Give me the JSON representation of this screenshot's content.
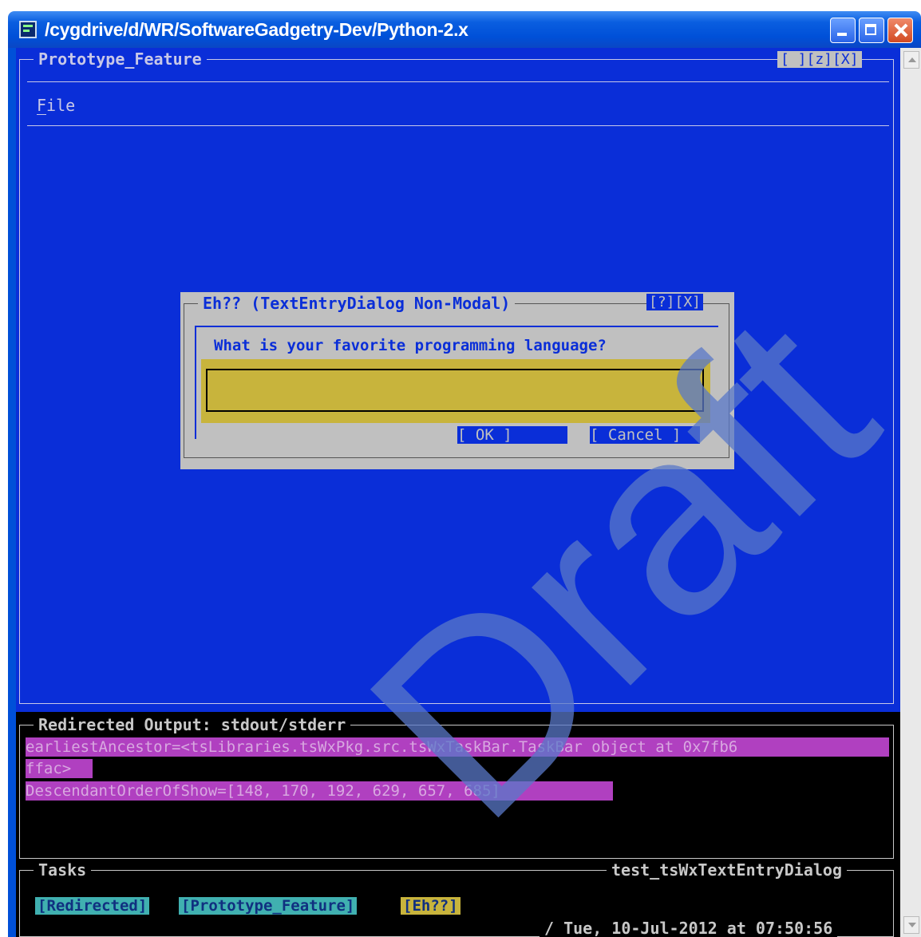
{
  "window": {
    "title": "/cygdrive/d/WR/SoftwareGadgetry-Dev/Python-2.x"
  },
  "main_window": {
    "title": "Prototype_Feature",
    "title_buttons": "[ ][z][X]",
    "menu_file": "File"
  },
  "dialog": {
    "title": "Eh?? (TextEntryDialog Non-Modal)",
    "title_buttons": "[?][X]",
    "prompt": "What is your favorite programming language?",
    "entry_value": "",
    "ok_label": "[   OK   ]",
    "cancel_label": "[ Cancel ]"
  },
  "output": {
    "title": "Redirected Output: stdout/stderr",
    "lines": [
      "earliestAncestor=<tsLibraries.tsWxPkg.src.tsWxTaskBar.TaskBar object at 0x7fb6",
      "ffac>",
      "DescendantOrderOfShow=[148, 170, 192, 629, 657, 685]"
    ]
  },
  "tasks": {
    "title": "Tasks",
    "app_name": "test_tsWxTextEntryDialog",
    "items": [
      "[Redirected]",
      "[Prototype_Feature]",
      "[Eh??]"
    ],
    "clock": "/ Tue, 10-Jul-2012 at 07:50:56"
  },
  "watermark": "Draft",
  "colors": {
    "terminal_blue": "#0a2ed8",
    "dialog_gray": "#c0c0c0",
    "entry_yellow": "#c8b43c",
    "output_magenta": "#b040c0",
    "task_cyan": "#40b0b0",
    "task_yellow": "#c8b43c"
  }
}
